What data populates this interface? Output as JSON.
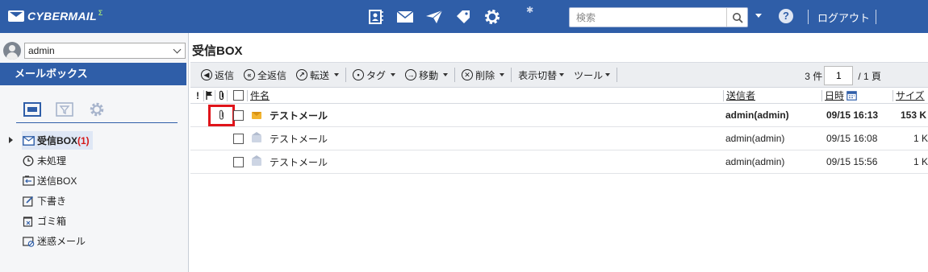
{
  "app": {
    "logo_text": "CYBERMAIL",
    "logo_mark": "Σ"
  },
  "header": {
    "nav_icons": [
      "contacts-book-icon",
      "mail-envelope-icon",
      "paper-plane-icon",
      "tag-icon",
      "settings-gear-icon"
    ],
    "search_placeholder": "検索",
    "help_label": "?",
    "logout_label": "ログアウト"
  },
  "sidebar": {
    "user": "admin",
    "mailbox_title": "メールボックス",
    "tabs": [
      "folder-tab-icon",
      "filter-tab-icon",
      "settings-tab-icon"
    ],
    "folders": [
      {
        "label": "受信BOX",
        "count": "(1)",
        "icon": "inbox-icon",
        "selected": true
      },
      {
        "label": "未処理",
        "count": "",
        "icon": "clock-icon",
        "selected": false
      },
      {
        "label": "送信BOX",
        "count": "",
        "icon": "sent-box-icon",
        "selected": false
      },
      {
        "label": "下書き",
        "count": "",
        "icon": "draft-pencil-icon",
        "selected": false
      },
      {
        "label": "ゴミ箱",
        "count": "",
        "icon": "trash-icon",
        "selected": false
      },
      {
        "label": "迷惑メール",
        "count": "",
        "icon": "spam-folder-icon",
        "selected": false
      }
    ]
  },
  "main": {
    "title": "受信BOX",
    "toolbar": {
      "reply": "返信",
      "reply_all": "全返信",
      "forward": "転送",
      "tag": "タグ",
      "move": "移動",
      "delete": "削除",
      "view_toggle": "表示切替",
      "tools": "ツール"
    },
    "pager": {
      "count_label": "3 件",
      "page_value": "1",
      "total_label": "/ 1 頁"
    },
    "table": {
      "headers": {
        "important": "!",
        "subject": "件名",
        "sender": "送信者",
        "date": "日時",
        "size": "サイズ"
      },
      "rows": [
        {
          "subject": "テストメール",
          "sender": "admin(admin)",
          "date": "09/15 16:13",
          "size": "153 K",
          "unread": true,
          "attachment": true
        },
        {
          "subject": "テストメール",
          "sender": "admin(admin)",
          "date": "09/15 16:08",
          "size": "1 K",
          "unread": false,
          "attachment": false
        },
        {
          "subject": "テストメール",
          "sender": "admin(admin)",
          "date": "09/15 15:56",
          "size": "1 K",
          "unread": false,
          "attachment": false
        }
      ]
    }
  },
  "colors": {
    "brand_blue": "#2f5ea8",
    "highlight_red": "#e0141a",
    "unread_count_red": "#d51a1a"
  }
}
